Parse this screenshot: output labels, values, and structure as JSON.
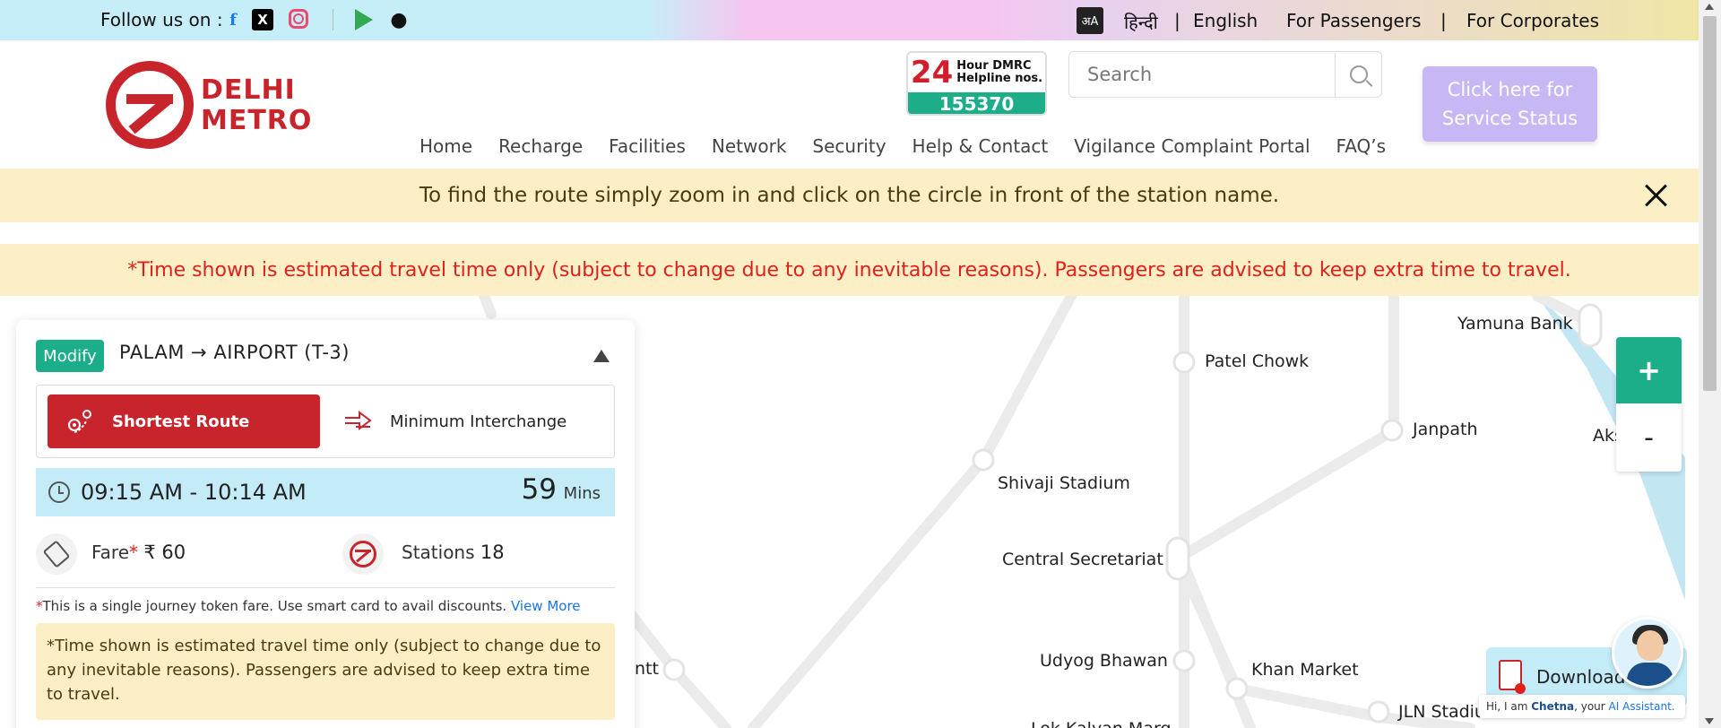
{
  "topbar": {
    "follow_label": "Follow us on :",
    "social_icons": [
      "facebook-icon",
      "x-icon",
      "instagram-icon",
      "google-play-icon",
      "apple-icon"
    ],
    "hindi": "हिन्दी",
    "divider": "|",
    "english": "English",
    "for_passengers": "For Passengers",
    "for_corporates": "For Corporates"
  },
  "header": {
    "logo_line1": "DELHI",
    "logo_line2": "METRO",
    "helpline_big": "24",
    "helpline_line1": "Hour DMRC",
    "helpline_line2": "Helpline nos.",
    "helpline_number": "155370",
    "search_placeholder": "Search",
    "status_button_line1": "Click here for",
    "status_button_line2": "Service Status",
    "brand_color": "#c8242b",
    "accent_color": "#1bae88"
  },
  "nav": [
    "Home",
    "Recharge",
    "Facilities",
    "Network",
    "Security",
    "Help & Contact",
    "Vigilance Complaint Portal",
    "FAQ’s"
  ],
  "notices": {
    "zoom_hint": "To find the route simply zoom in and click on the circle in front of the station name.",
    "time_warning": "*Time shown is estimated travel time only (subject to change due to any inevitable reasons). Passengers are advised to keep extra time to travel."
  },
  "map": {
    "stations": [
      "Yamuna Bank",
      "Patel Chowk",
      "Janpath",
      "Aks",
      "Shivaji Stadium",
      "Central Secretariat",
      "Udyog Bhawan",
      "Khan Market",
      "JLN Stadiu",
      "ntt",
      "Lok Kalyan Marg"
    ],
    "zoom_in": "+",
    "zoom_out": "-"
  },
  "route": {
    "modify_label": "Modify",
    "from": "PALAM",
    "arrow": "→",
    "to": "AIRPORT (T-3)",
    "shortest_label": "Shortest Route",
    "min_interchange_label": "Minimum Interchange",
    "time_range": "09:15 AM - 10:14 AM",
    "duration": "59",
    "duration_unit": "Mins",
    "fare_label": "Fare",
    "star": "*",
    "fare_value": "₹ 60",
    "stations_label": "Stations",
    "stations_count": "18",
    "note_text": "This is a single journey token fare. Use smart card to avail discounts.",
    "view_more": "View More",
    "panel_notice": "*Time shown is estimated travel time only (subject to change due to any inevitable reasons). Passengers are advised to keep extra time to travel."
  },
  "download": {
    "label": "Download"
  },
  "chatbot": {
    "greeting_prefix": "Hi, I am",
    "name": "Chetna",
    "greeting_mid": ", your",
    "role": "AI Assistant."
  }
}
